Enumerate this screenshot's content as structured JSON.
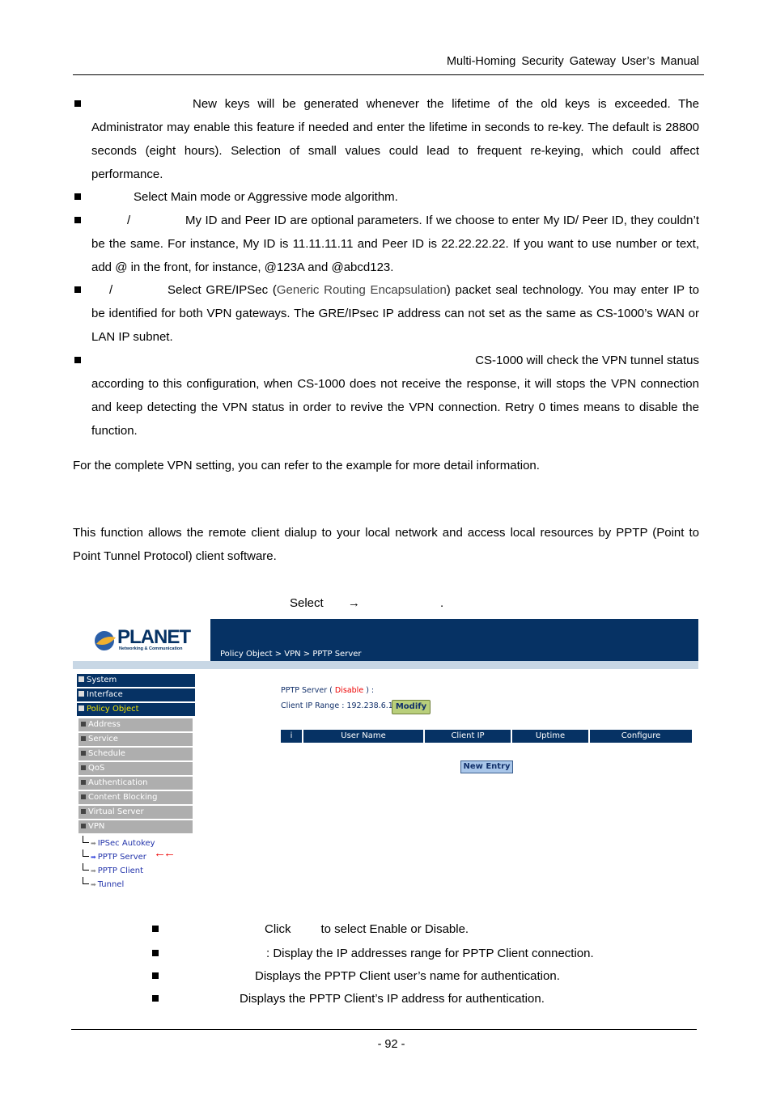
{
  "header": {
    "title": "Multi-Homing  Security  Gateway  User’s  Manual"
  },
  "bullets_top": [
    {
      "text": "New keys will be generated whenever the lifetime of the old keys is exceeded. The Administrator may enable this feature if needed and enter the lifetime in seconds to re-key.    The default is 28800 seconds (eight hours). Selection of small values could lead to frequent re-keying, which could affect performance."
    },
    {
      "text": "Select Main mode or Aggressive mode algorithm."
    },
    {
      "slash": "/",
      "text": "My ID and Peer ID are optional parameters. If we choose to enter My ID/ Peer ID, they couldn’t be the same. For instance, My ID is 11.11.11.11 and Peer ID is 22.22.22.22. If you want to use number or text, add @ in the front, for instance, @123A and @abcd123."
    },
    {
      "slash": "/",
      "text_a": "Select GRE/IPSec (",
      "text_gray": "Generic Routing Encapsulation",
      "text_b": ") packet seal technology. You may enter IP to be identified for both VPN gateways. The GRE/IPsec IP address can not set as the same as CS-1000’s WAN or LAN IP subnet."
    },
    {
      "text_first": "CS-1000 will check the VPN tunnel status",
      "text": "according to this configuration, when CS-1000 does not receive the response, it will stops the VPN connection and keep detecting the VPN status in order to revive the VPN connection. Retry 0 times means to disable the function."
    }
  ],
  "para_vpn": "For the complete VPN setting, you can refer to the example for more detail information.",
  "para_pptp": "This function allows the remote client dialup to your local network and access local resources by PPTP (Point to Point Tunnel Protocol) client software.",
  "select_line": {
    "select": "Select",
    "arrow": "→",
    "dot": "."
  },
  "screenshot": {
    "logo_text": "PLANET",
    "logo_sub": "Networking & Communication",
    "breadcrumb": "Policy Object > VPN > PPTP Server",
    "nav_main": [
      "System",
      "Interface",
      "Policy Object"
    ],
    "nav_sub": [
      "Address",
      "Service",
      "Schedule",
      "QoS",
      "Authentication",
      "Content Blocking",
      "Virtual Server",
      "VPN"
    ],
    "nav_leaves": [
      "IPSec Autokey",
      "PPTP Server",
      "PPTP Client",
      "Tunnel"
    ],
    "pointer_arrows": "←←",
    "server_label": "PPTP Server (",
    "server_status": "Disable",
    "server_label_end": ") :",
    "client_ip_range": "Client IP Range : 192.238.6.1-254",
    "modify_button": "Modify",
    "table_headers": [
      "i",
      "User Name",
      "Client IP",
      "Uptime",
      "Configure"
    ],
    "new_entry_button": "New  Entry"
  },
  "bullets_bottom": [
    {
      "a": "Click",
      "b": "to select Enable or Disable."
    },
    {
      "b": ": Display the IP addresses range for PPTP Client connection."
    },
    {
      "b": "Displays the PPTP Client user’s name for authentication."
    },
    {
      "b": "Displays the PPTP Client’s IP address for authentication."
    }
  ],
  "footer": {
    "page": "- 92 -"
  }
}
